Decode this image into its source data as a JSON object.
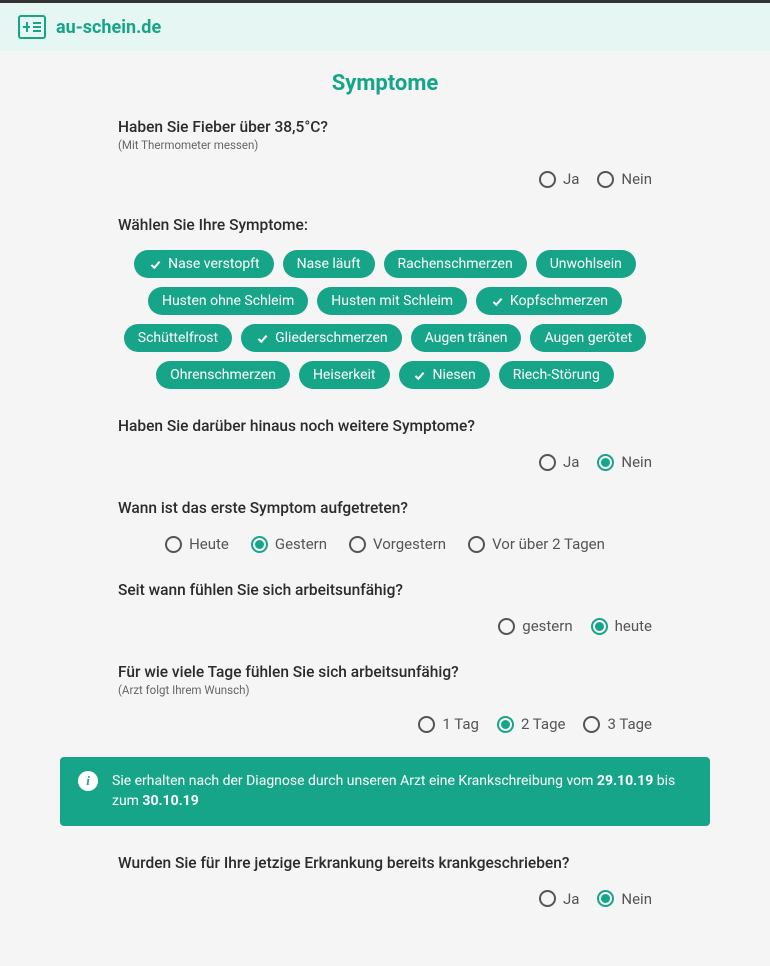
{
  "brand": "au-schein.de",
  "title": "Symptome",
  "q1": {
    "label": "Haben Sie Fieber über 38,5°C?",
    "sub": "(Mit Thermometer messen)",
    "options": [
      {
        "label": "Ja",
        "selected": false
      },
      {
        "label": "Nein",
        "selected": false
      }
    ]
  },
  "q2": {
    "label": "Wählen Sie Ihre Symptome:",
    "chips": [
      {
        "label": "Nase verstopft",
        "selected": true
      },
      {
        "label": "Nase läuft",
        "selected": false
      },
      {
        "label": "Rachenschmerzen",
        "selected": false
      },
      {
        "label": "Unwohlsein",
        "selected": false
      },
      {
        "label": "Husten ohne Schleim",
        "selected": false
      },
      {
        "label": "Husten mit Schleim",
        "selected": false
      },
      {
        "label": "Kopfschmerzen",
        "selected": true
      },
      {
        "label": "Schüttelfrost",
        "selected": false
      },
      {
        "label": "Gliederschmerzen",
        "selected": true
      },
      {
        "label": "Augen tränen",
        "selected": false
      },
      {
        "label": "Augen gerötet",
        "selected": false
      },
      {
        "label": "Ohrenschmerzen",
        "selected": false
      },
      {
        "label": "Heiserkeit",
        "selected": false
      },
      {
        "label": "Niesen",
        "selected": true
      },
      {
        "label": "Riech-Störung",
        "selected": false
      }
    ]
  },
  "q3": {
    "label": "Haben Sie darüber hinaus noch weitere Symptome?",
    "options": [
      {
        "label": "Ja",
        "selected": false
      },
      {
        "label": "Nein",
        "selected": true
      }
    ]
  },
  "q4": {
    "label": "Wann ist das erste Symptom aufgetreten?",
    "options": [
      {
        "label": "Heute",
        "selected": false
      },
      {
        "label": "Gestern",
        "selected": true
      },
      {
        "label": "Vorgestern",
        "selected": false
      },
      {
        "label": "Vor über 2 Tagen",
        "selected": false
      }
    ]
  },
  "q5": {
    "label": "Seit wann fühlen Sie sich arbeitsunfähig?",
    "options": [
      {
        "label": "gestern",
        "selected": false
      },
      {
        "label": "heute",
        "selected": true
      }
    ]
  },
  "q6": {
    "label": "Für wie viele Tage fühlen Sie sich arbeitsunfähig?",
    "sub": "(Arzt folgt Ihrem Wunsch)",
    "options": [
      {
        "label": "1 Tag",
        "selected": false
      },
      {
        "label": "2 Tage",
        "selected": true
      },
      {
        "label": "3 Tage",
        "selected": false
      }
    ]
  },
  "banner": {
    "text_pre": "Sie erhalten nach der Diagnose durch unseren Arzt eine Krankschreibung vom ",
    "date_from": "29.10.19",
    "text_mid": " bis zum ",
    "date_to": "30.10.19"
  },
  "q7": {
    "label": "Wurden Sie für Ihre jetzige Erkrankung bereits krankgeschrieben?",
    "options": [
      {
        "label": "Ja",
        "selected": false
      },
      {
        "label": "Nein",
        "selected": true
      }
    ]
  }
}
